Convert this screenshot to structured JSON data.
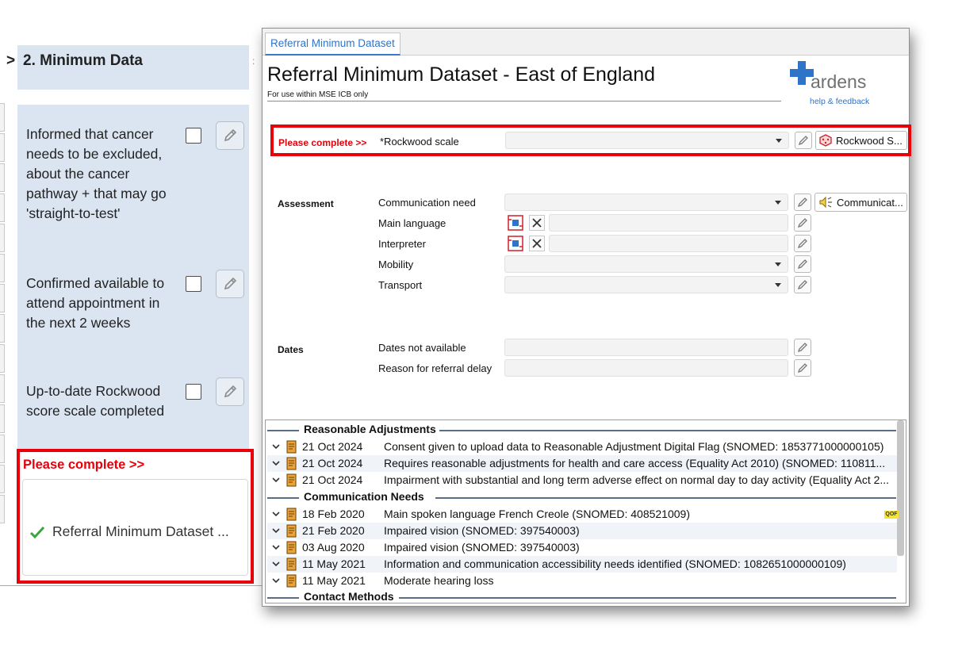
{
  "left": {
    "section_arrow": ">",
    "section_title": "2. Minimum Data",
    "header_separator": ":",
    "tasks": [
      {
        "label": "Informed that cancer needs to be excluded, about the cancer pathway + that may go 'straight-to-test'"
      },
      {
        "label": "Confirmed available to attend appointment in the next 2 weeks"
      },
      {
        "label": "Up-to-date Rockwood score scale completed"
      }
    ],
    "please_complete": "Please complete >>",
    "completed_item": "Referral Minimum Dataset ..."
  },
  "window": {
    "tab": "Referral Minimum Dataset",
    "title": "Referral Minimum Dataset - East of England",
    "subtitle": "For use within MSE ICB only",
    "logo": {
      "brand": "ardens",
      "help": "help & feedback",
      "accent": "#2e74c9"
    },
    "rockwood": {
      "please_label": "Please complete >>",
      "label": "*Rockwood scale",
      "button": "Rockwood S..."
    },
    "assessment": {
      "group": "Assessment",
      "rows": [
        {
          "label": "Communication need",
          "button": "Communicat..."
        },
        {
          "label": "Main language"
        },
        {
          "label": "Interpreter"
        },
        {
          "label": "Mobility"
        },
        {
          "label": "Transport"
        }
      ]
    },
    "dates": {
      "group": "Dates",
      "rows": [
        {
          "label": "Dates not available"
        },
        {
          "label": "Reason for referral delay"
        }
      ]
    },
    "history": {
      "sections": [
        {
          "title": "Reasonable Adjustments",
          "rows": [
            {
              "date": "21 Oct 2024",
              "text": "Consent given to upload data to Reasonable Adjustment Digital Flag (SNOMED: 1853771000000105)"
            },
            {
              "date": "21 Oct 2024",
              "text": "Requires reasonable adjustments for health and care access (Equality Act 2010) (SNOMED: 110811..."
            },
            {
              "date": "21 Oct 2024",
              "text": "Impairment with substantial and long term adverse effect on normal day to day activity (Equality Act 2..."
            }
          ]
        },
        {
          "title": "Communication Needs",
          "rows": [
            {
              "date": "18 Feb 2020",
              "text": "Main spoken language French Creole (SNOMED: 408521009)",
              "badge": "QOF"
            },
            {
              "date": "21 Feb 2020",
              "text": "Impaired vision (SNOMED: 397540003)"
            },
            {
              "date": "03 Aug 2020",
              "text": "Impaired vision (SNOMED: 397540003)"
            },
            {
              "date": "11 May 2021",
              "text": "Information and communication accessibility needs identified (SNOMED: 1082651000000109)"
            },
            {
              "date": "11 May 2021",
              "text": "Moderate hearing loss"
            }
          ]
        },
        {
          "title": "Contact Methods",
          "rows": []
        }
      ]
    }
  },
  "colors": {
    "alert_red": "#e8000b",
    "panel_blue": "#dbe5f1",
    "link_blue": "#2e74c9",
    "check_green": "#3aa63a"
  },
  "icons": [
    "pencil-icon",
    "checkmark-icon",
    "chevron-down-icon",
    "scroll-icon",
    "dice-icon",
    "speaker-icon",
    "language-icon",
    "close-icon",
    "ardens-logo-icon"
  ]
}
